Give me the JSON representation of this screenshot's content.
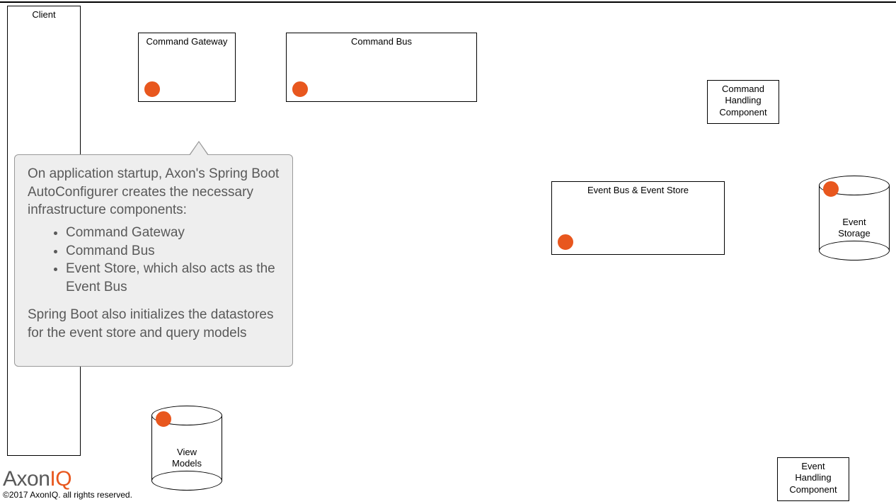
{
  "boxes": {
    "client": {
      "label": "Client"
    },
    "command_gateway": {
      "label": "Command Gateway"
    },
    "command_bus": {
      "label": "Command Bus"
    },
    "command_handling": {
      "label": "Command\nHandling\nComponent"
    },
    "event_bus_store": {
      "label": "Event Bus & Event Store"
    },
    "event_handling": {
      "label": "Event\nHandling\nComponent"
    }
  },
  "cylinders": {
    "event_storage": {
      "label": "Event\nStorage"
    },
    "view_models": {
      "label": "View\nModels"
    }
  },
  "callout": {
    "para1": "On application startup, Axon's Spring Boot AutoConfigurer creates the necessary infrastructure components:",
    "bullets": [
      "Command Gateway",
      "Command Bus",
      "Event Store, which also acts as the Event Bus"
    ],
    "para2": "Spring Boot also initializes the datastores for the event store and query models"
  },
  "logo": {
    "part1": "Axon",
    "part2": "IQ"
  },
  "copyright": "©2017 AxonIQ. all rights reserved.",
  "marker_color": "#e8571e"
}
